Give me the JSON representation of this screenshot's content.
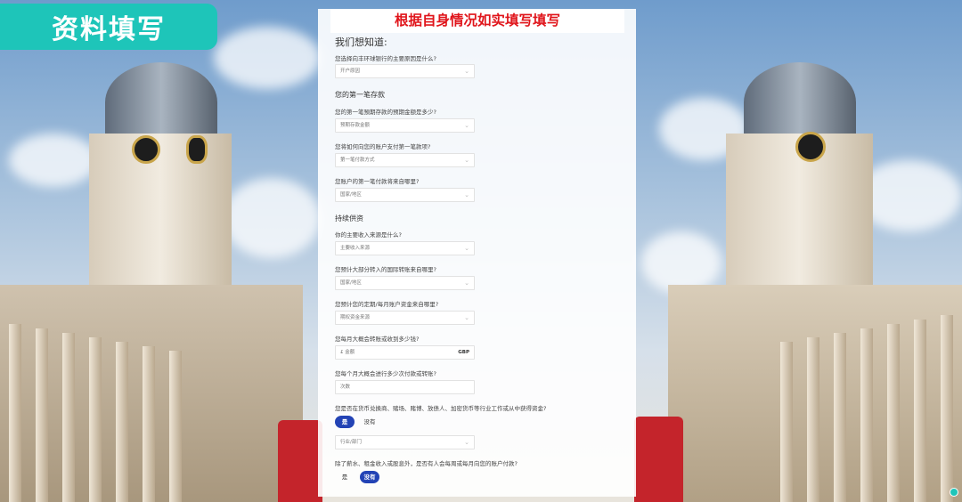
{
  "badge": {
    "title": "资料填写"
  },
  "form": {
    "banner": "根据自身情况如实填写填写",
    "heading_main": "我们想知道:",
    "q_reason": "您选择向丰环球银行的主要原因是什么?",
    "q_reason_value": "开户原因",
    "section_first_deposit": "您的第一笔存款",
    "q_first_amount": "您的第一笔預期存款的预期金额是多少?",
    "q_first_amount_value": "预期存款金额",
    "q_first_method": "您将如何向您的账户支付第一笔款项?",
    "q_first_method_value": "第一笔付款方式",
    "q_first_origin": "您账户的第一笔付款将来自哪里?",
    "q_first_origin_value": "国家/地区",
    "section_ongoing": "持续供资",
    "q_income_source": "你的主要收入来源是什么?",
    "q_income_source_value": "主要收入来源",
    "q_intl_origin": "您预计大部分转入的国际转账来自哪里?",
    "q_intl_origin_value": "国家/地区",
    "q_regular_source": "您预计您的定期/每月账户资金来自哪里?",
    "q_regular_source_value": "期权资金来源",
    "q_monthly_amount": "您每月大概会转账或收到多少钱?",
    "q_monthly_amount_value": "£ 金额",
    "q_monthly_amount_unit": "GBP",
    "q_monthly_count": "您每个月大概会进行多少次付款或转账?",
    "q_monthly_count_value": "次数",
    "q_industry": "您是否在货币兑换商、赌场、赌博、放债人、加密货币等行业工作或从中获得资金?",
    "q_industry_yes": "是",
    "q_industry_no": "没有",
    "q_industry_select": "行业/部门",
    "q_third_party": "除了薪水、租金收入或股息外，是否有人会每周或每月向您的账户付款?",
    "q_third_party_yes": "是",
    "q_third_party_no": "没有"
  },
  "colors": {
    "accent": "#1ec5b9",
    "banner_text": "#e0151b",
    "toggle_on": "#2343b5"
  }
}
